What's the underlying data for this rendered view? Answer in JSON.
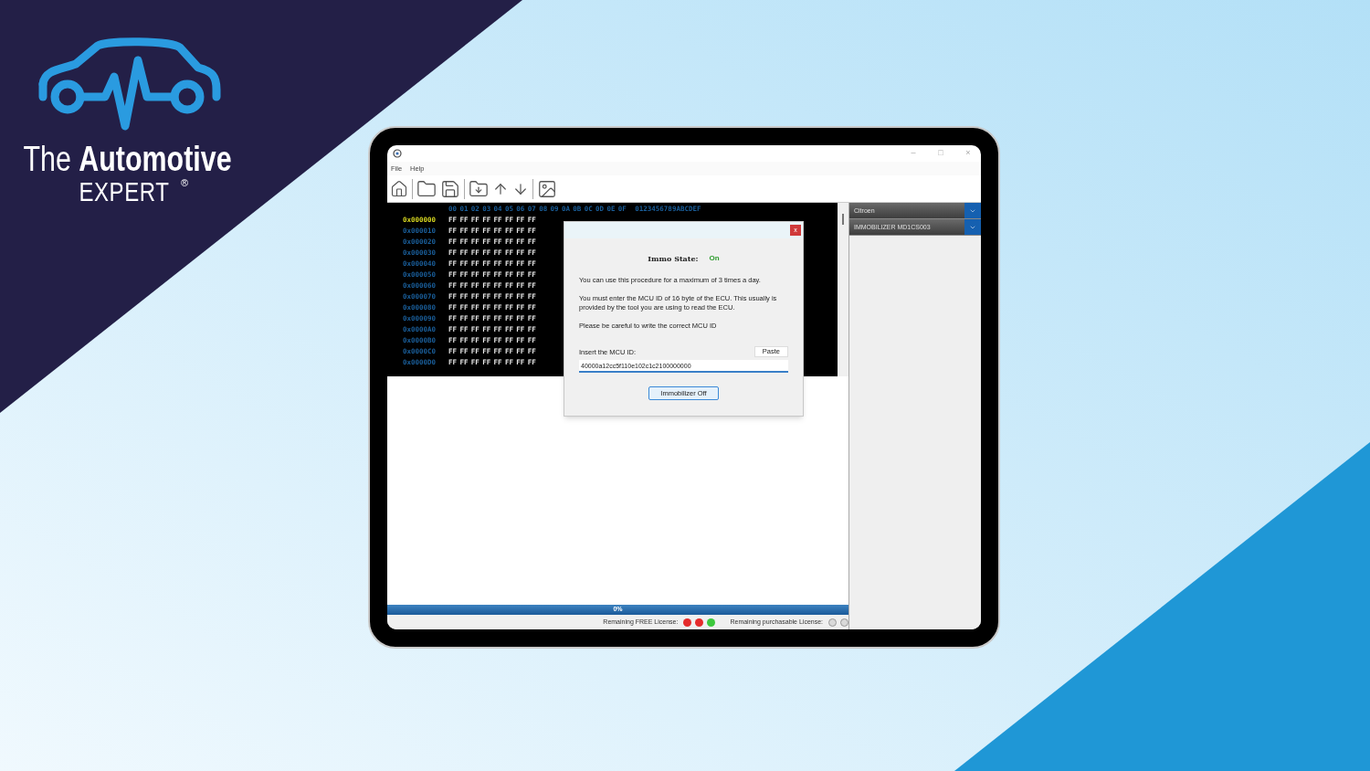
{
  "brand": {
    "title": "The **Automotive**",
    "subtitle": "EXPERT",
    "mark": "®"
  },
  "window": {
    "controls": [
      "–",
      "□",
      "×"
    ]
  },
  "menu": [
    "File",
    "Help"
  ],
  "hex_view": {
    "columns": [
      "00",
      "01",
      "02",
      "03",
      "04",
      "05",
      "06",
      "07",
      "08",
      "09",
      "0A",
      "0B",
      "0C",
      "0D",
      "0E",
      "0F"
    ],
    "ascii_header": "0123456789ABCDEF",
    "rows": [
      {
        "offset": "0x000000",
        "bytes": [
          "FF",
          "FF",
          "FF",
          "FF",
          "FF",
          "FF",
          "FF",
          "FF"
        ],
        "selected": true
      },
      {
        "offset": "0x000010",
        "bytes": [
          "FF",
          "FF",
          "FF",
          "FF",
          "FF",
          "FF",
          "FF",
          "FF"
        ],
        "selected": false
      },
      {
        "offset": "0x000020",
        "bytes": [
          "FF",
          "FF",
          "FF",
          "FF",
          "FF",
          "FF",
          "FF",
          "FF"
        ],
        "selected": false
      },
      {
        "offset": "0x000030",
        "bytes": [
          "FF",
          "FF",
          "FF",
          "FF",
          "FF",
          "FF",
          "FF",
          "FF"
        ],
        "selected": false
      },
      {
        "offset": "0x000040",
        "bytes": [
          "FF",
          "FF",
          "FF",
          "FF",
          "FF",
          "FF",
          "FF",
          "FF"
        ],
        "selected": false
      },
      {
        "offset": "0x000050",
        "bytes": [
          "FF",
          "FF",
          "FF",
          "FF",
          "FF",
          "FF",
          "FF",
          "FF"
        ],
        "selected": false
      },
      {
        "offset": "0x000060",
        "bytes": [
          "FF",
          "FF",
          "FF",
          "FF",
          "FF",
          "FF",
          "FF",
          "FF"
        ],
        "selected": false
      },
      {
        "offset": "0x000070",
        "bytes": [
          "FF",
          "FF",
          "FF",
          "FF",
          "FF",
          "FF",
          "FF",
          "FF"
        ],
        "selected": false
      },
      {
        "offset": "0x000080",
        "bytes": [
          "FF",
          "FF",
          "FF",
          "FF",
          "FF",
          "FF",
          "FF",
          "FF"
        ],
        "selected": false
      },
      {
        "offset": "0x000090",
        "bytes": [
          "FF",
          "FF",
          "FF",
          "FF",
          "FF",
          "FF",
          "FF",
          "FF"
        ],
        "selected": false
      },
      {
        "offset": "0x0000A0",
        "bytes": [
          "FF",
          "FF",
          "FF",
          "FF",
          "FF",
          "FF",
          "FF",
          "FF"
        ],
        "selected": false
      },
      {
        "offset": "0x0000B0",
        "bytes": [
          "FF",
          "FF",
          "FF",
          "FF",
          "FF",
          "FF",
          "FF",
          "FF"
        ],
        "selected": false
      },
      {
        "offset": "0x0000C0",
        "bytes": [
          "FF",
          "FF",
          "FF",
          "FF",
          "FF",
          "FF",
          "FF",
          "FF"
        ],
        "selected": false
      },
      {
        "offset": "0x0000D0",
        "bytes": [
          "FF",
          "FF",
          "FF",
          "FF",
          "FF",
          "FF",
          "FF",
          "FF"
        ],
        "selected": false
      }
    ]
  },
  "right_panel": {
    "selects": [
      "Citroen",
      "IMMOBILIZER MD1CS003"
    ]
  },
  "progress": {
    "text": "0%",
    "level": 0
  },
  "status_bar": {
    "free_label": "Remaining FREE License:",
    "free_dots": [
      {
        "color": "#e52b2b"
      },
      {
        "color": "#e52b2b"
      },
      {
        "color": "#3cc83c"
      }
    ],
    "purchasable_label": "Remaining purchasable License:",
    "purchasable_dots": [
      {
        "color": "#d9d9d9"
      },
      {
        "color": "#d9d9d9"
      }
    ]
  },
  "dialog": {
    "close": "x",
    "state_label": "Immo State:",
    "state_value": "On",
    "state_on": true,
    "paragraphs": [
      "You can use this procedure for a maximum of 3 times a day.",
      "You must enter the MCU ID of 16 byte of the ECU. This usually is provided by the tool you are using to read the ECU.",
      "Please be careful to write the correct MCU ID"
    ],
    "input_label": "Insert the MCU ID:",
    "paste": "Paste",
    "value": "40000a12cc5f110e102c1c2100000000",
    "action": "Immobilizer Off"
  }
}
